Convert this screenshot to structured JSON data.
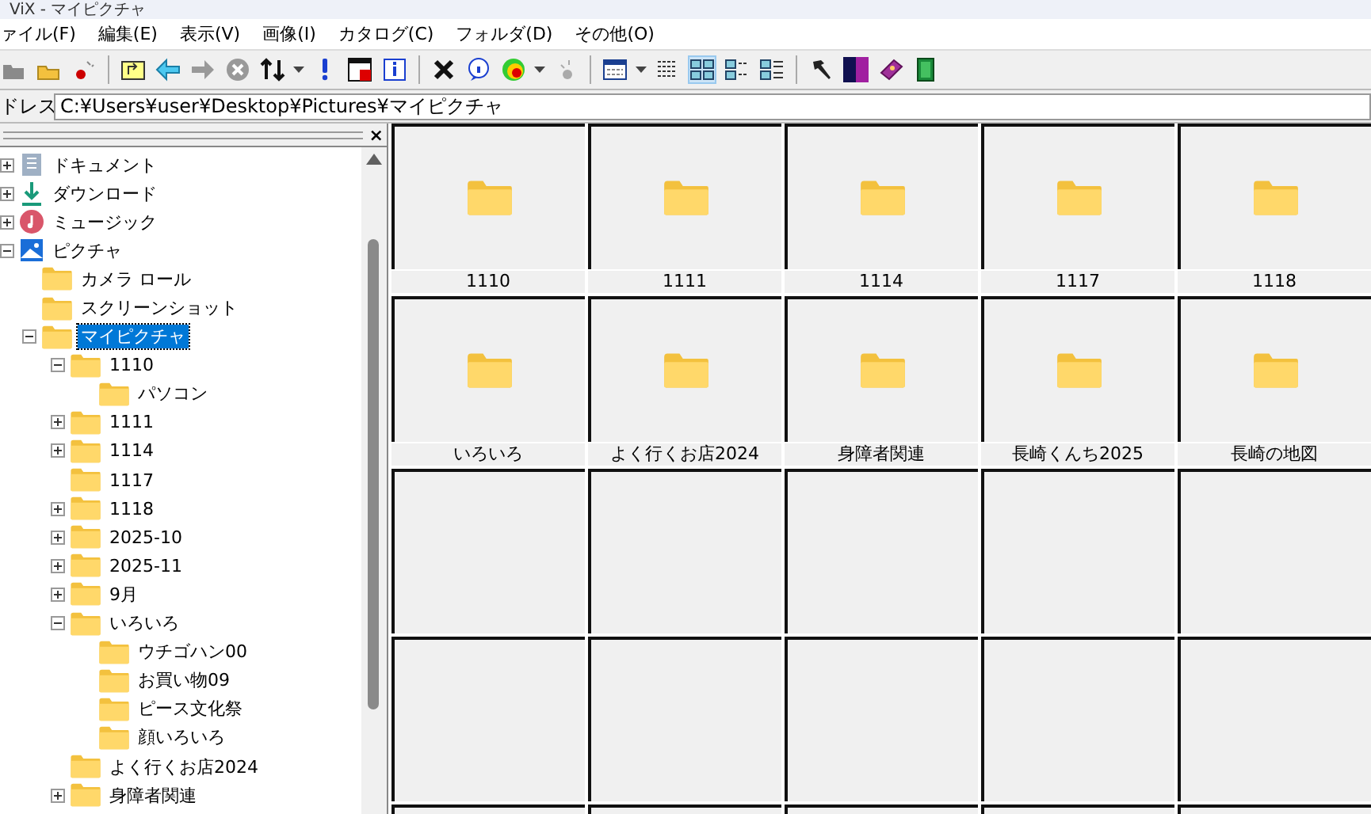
{
  "window": {
    "title": "ViX - マイピクチャ"
  },
  "menu": [
    "ァイル(F)",
    "編集(E)",
    "表示(V)",
    "画像(I)",
    "カタログ(C)",
    "フォルダ(D)",
    "その他(O)"
  ],
  "view_modes": [
    {
      "selected": true
    },
    {
      "selected": false
    },
    {
      "selected": false
    }
  ],
  "tree_pane": {
    "close": "×"
  },
  "address": {
    "label": "ドレス",
    "value": "C:¥Users¥user¥Desktop¥Pictures¥マイピクチャ"
  },
  "tree": [
    {
      "label": "ドキュメント",
      "kind": "document",
      "expanded": false,
      "selected": false
    },
    {
      "label": "ダウンロード",
      "kind": "download",
      "expanded": false,
      "selected": false
    },
    {
      "label": "ミュージック",
      "kind": "music",
      "expanded": false,
      "selected": false
    },
    {
      "label": "ピクチャ",
      "kind": "picture",
      "expanded": true,
      "selected": false,
      "children": [
        {
          "label": "カメラ ロール",
          "kind": "folder",
          "selected": false
        },
        {
          "label": "スクリーンショット",
          "kind": "folder",
          "selected": false
        },
        {
          "label": "マイピクチャ",
          "kind": "folder",
          "expanded": true,
          "selected": true,
          "children": [
            {
              "label": "1110",
              "kind": "folder",
              "expanded": true,
              "selected": false,
              "children": [
                {
                  "label": "パソコン",
                  "kind": "folder",
                  "selected": false
                }
              ]
            },
            {
              "label": "1111",
              "kind": "folder",
              "expanded": false,
              "selected": false
            },
            {
              "label": "1114",
              "kind": "folder",
              "expanded": false,
              "selected": false
            },
            {
              "label": "1117",
              "kind": "folder",
              "selected": false
            },
            {
              "label": "1118",
              "kind": "folder",
              "expanded": false,
              "selected": false
            },
            {
              "label": "2025-10",
              "kind": "folder",
              "expanded": false,
              "selected": false
            },
            {
              "label": "2025-11",
              "kind": "folder",
              "expanded": false,
              "selected": false
            },
            {
              "label": "9月",
              "kind": "folder",
              "expanded": false,
              "selected": false
            },
            {
              "label": "いろいろ",
              "kind": "folder",
              "expanded": true,
              "selected": false,
              "children": [
                {
                  "label": "ウチゴハン00",
                  "kind": "folder",
                  "selected": false
                },
                {
                  "label": "お買い物09",
                  "kind": "folder",
                  "selected": false
                },
                {
                  "label": "ピース文化祭",
                  "kind": "folder",
                  "selected": false
                },
                {
                  "label": "顔いろいろ",
                  "kind": "folder",
                  "selected": false
                }
              ]
            },
            {
              "label": "よく行くお店2024",
              "kind": "folder",
              "selected": false
            },
            {
              "label": "身障者関連",
              "kind": "folder",
              "expanded": false,
              "selected": false
            }
          ]
        }
      ]
    }
  ],
  "thumbnails": [
    {
      "kind": "folder",
      "label": "1110"
    },
    {
      "kind": "folder",
      "label": "1111"
    },
    {
      "kind": "folder",
      "label": "1114"
    },
    {
      "kind": "folder",
      "label": "1117"
    },
    {
      "kind": "folder",
      "label": "1118"
    },
    {
      "kind": "folder",
      "label": "いろいろ"
    },
    {
      "kind": "folder",
      "label": "よく行くお店2024"
    },
    {
      "kind": "folder",
      "label": "身障者関連"
    },
    {
      "kind": "folder",
      "label": "長崎くんち2025"
    },
    {
      "kind": "folder",
      "label": "長崎の地図"
    },
    {
      "kind": "empty"
    },
    {
      "kind": "empty"
    },
    {
      "kind": "empty"
    },
    {
      "kind": "empty"
    },
    {
      "kind": "empty"
    },
    {
      "kind": "empty"
    },
    {
      "kind": "empty"
    },
    {
      "kind": "empty"
    },
    {
      "kind": "empty"
    },
    {
      "kind": "empty"
    },
    {
      "kind": "empty"
    },
    {
      "kind": "empty"
    },
    {
      "kind": "empty"
    },
    {
      "kind": "empty"
    },
    {
      "kind": "empty"
    }
  ]
}
